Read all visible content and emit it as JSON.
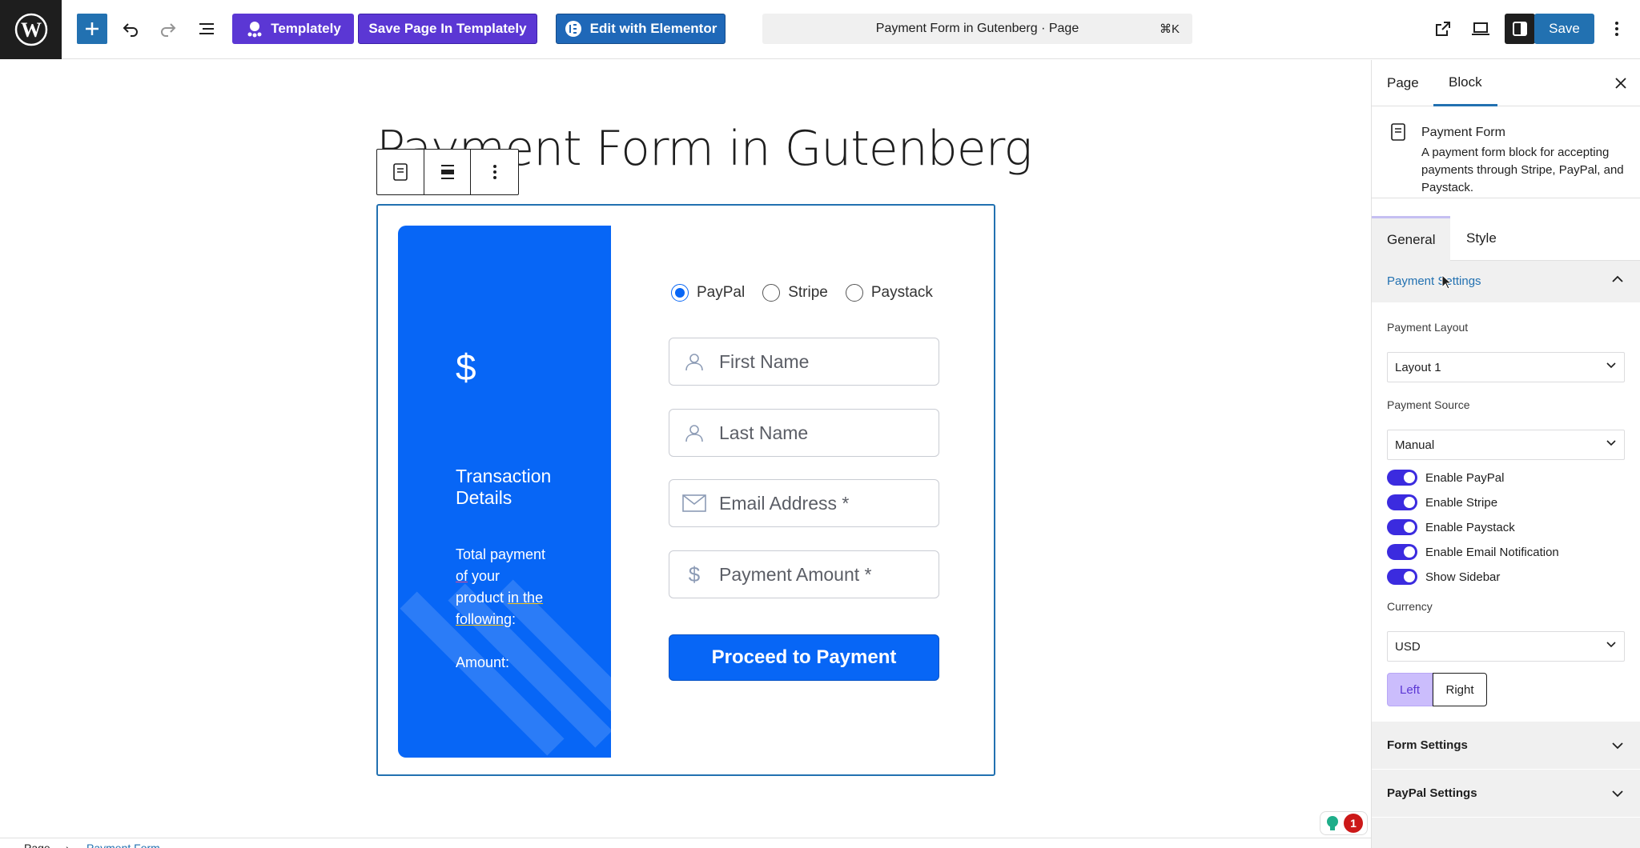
{
  "toolbar": {
    "templately_label": "Templately",
    "save_templately_label": "Save Page In Templately",
    "elementor_label": "Edit with Elementor",
    "command_title": "Payment Form in Gutenberg · Page",
    "command_shortcut": "⌘K",
    "save_label": "Save"
  },
  "editor": {
    "page_title": "Payment Form in Gutenberg"
  },
  "payment_form": {
    "sidebar_symbol": "$",
    "sidebar_title": "Transaction Details",
    "sidebar_desc_1": "Total payment",
    "sidebar_desc_2": "of",
    "sidebar_desc_3": " your",
    "sidebar_desc_4": "product ",
    "sidebar_desc_5": "in the",
    "sidebar_desc_6": "following",
    "sidebar_desc_7": ":",
    "sidebar_amount": "Amount:",
    "gateways": [
      {
        "label": "PayPal",
        "checked": true
      },
      {
        "label": "Stripe",
        "checked": false
      },
      {
        "label": "Paystack",
        "checked": false
      }
    ],
    "fields": {
      "first_name": "First Name",
      "last_name": "Last Name",
      "email": "Email Address *",
      "amount": "Payment Amount *"
    },
    "submit_label": "Proceed to Payment"
  },
  "footer": {
    "breadcrumb_root": "Page",
    "breadcrumb_sep": "›",
    "breadcrumb_current": "Payment Form",
    "notification_count": "1"
  },
  "sidebar": {
    "tabs": {
      "page": "Page",
      "block": "Block"
    },
    "block": {
      "name": "Payment Form",
      "description": "A payment form block for accepting payments through Stripe, PayPal, and Paystack."
    },
    "inner_tabs": {
      "general": "General",
      "style": "Style"
    },
    "payment_settings": {
      "title": "Payment Settings",
      "layout_label": "Payment Layout",
      "layout_value": "Layout 1",
      "source_label": "Payment Source",
      "source_value": "Manual",
      "toggles": [
        {
          "label": "Enable PayPal",
          "on": true
        },
        {
          "label": "Enable Stripe",
          "on": true
        },
        {
          "label": "Enable Paystack",
          "on": true
        },
        {
          "label": "Enable Email Notification",
          "on": true
        },
        {
          "label": "Show Sidebar",
          "on": true
        }
      ],
      "currency_label": "Currency",
      "currency_value": "USD",
      "position_left": "Left",
      "position_right": "Right"
    },
    "form_settings_title": "Form Settings",
    "paypal_settings_title": "PayPal Settings"
  }
}
